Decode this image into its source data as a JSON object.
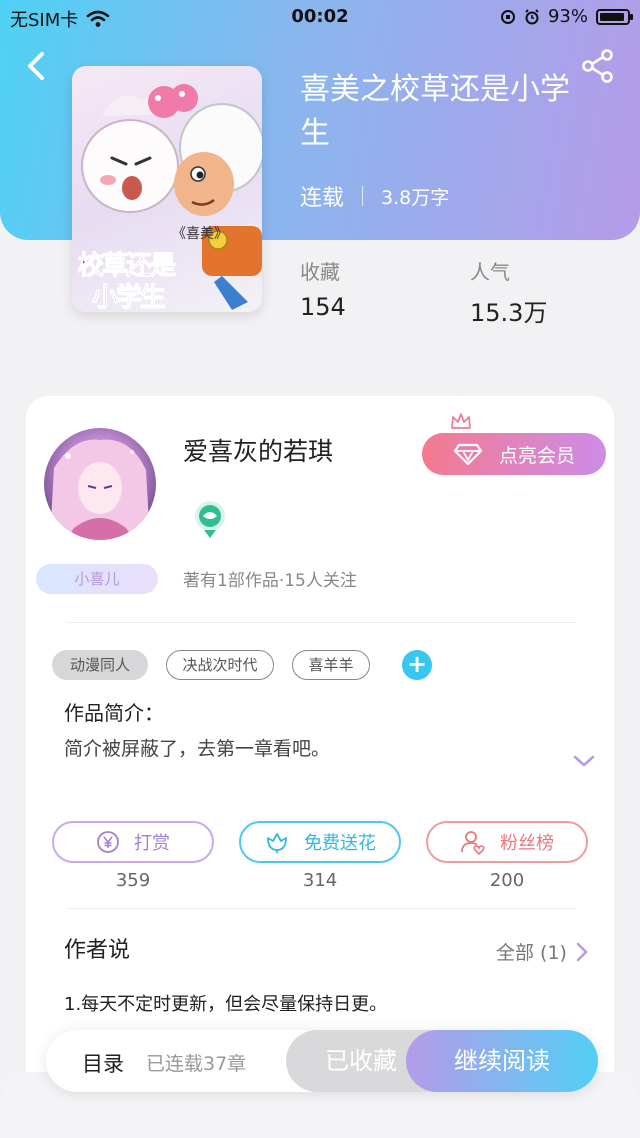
{
  "status_bar": {
    "carrier": "无SIM卡",
    "time": "00:02",
    "battery": "93%",
    "icons": [
      "wifi-icon",
      "orientation-lock-icon",
      "alarm-icon",
      "battery-icon"
    ]
  },
  "header": {
    "back_icon": "back-arrow-icon",
    "share_icon": "share-icon"
  },
  "book": {
    "cover_text": {
      "tag": "《喜美》",
      "title": "校草还是小学生"
    },
    "title": "喜美之校草还是小学生",
    "status": "连载",
    "word_count": "3.8万字",
    "stats": [
      {
        "label": "收藏",
        "value": "154"
      },
      {
        "label": "人气",
        "value": "15.3万"
      }
    ]
  },
  "author": {
    "name": "爱喜灰的若琪",
    "badge": "小喜儿",
    "stats": "著有1部作品·15人关注",
    "vip_button": "点亮会员"
  },
  "tags": {
    "items": [
      "动漫同人",
      "决战次时代",
      "喜羊羊"
    ],
    "add_label": "+"
  },
  "intro": {
    "title": "作品简介：",
    "text": "简介被屏蔽了，去第一章看吧。"
  },
  "actions": [
    {
      "label": "打赏",
      "count": "359",
      "icon": "yuan-coin-icon",
      "color": "#b08ae0"
    },
    {
      "label": "免费送花",
      "count": "314",
      "icon": "flower-icon",
      "color": "#35c2ec"
    },
    {
      "label": "粉丝榜",
      "count": "200",
      "icon": "fan-user-icon",
      "color": "#ec7f85"
    }
  ],
  "author_say": {
    "title": "作者说",
    "all_label": "全部 (1)",
    "text": "1.每天不定时更新，但会尽量保持日更。"
  },
  "bottom_bar": {
    "toc_label": "目录",
    "chapters": "已连载37章",
    "collected_label": "已收藏",
    "read_label": "继续阅读"
  },
  "colors": {
    "header_gradient_start": "#4fd1f5",
    "header_gradient_end": "#b59be8",
    "accent_blue": "#38c7f0",
    "accent_purple": "#b59be8"
  }
}
